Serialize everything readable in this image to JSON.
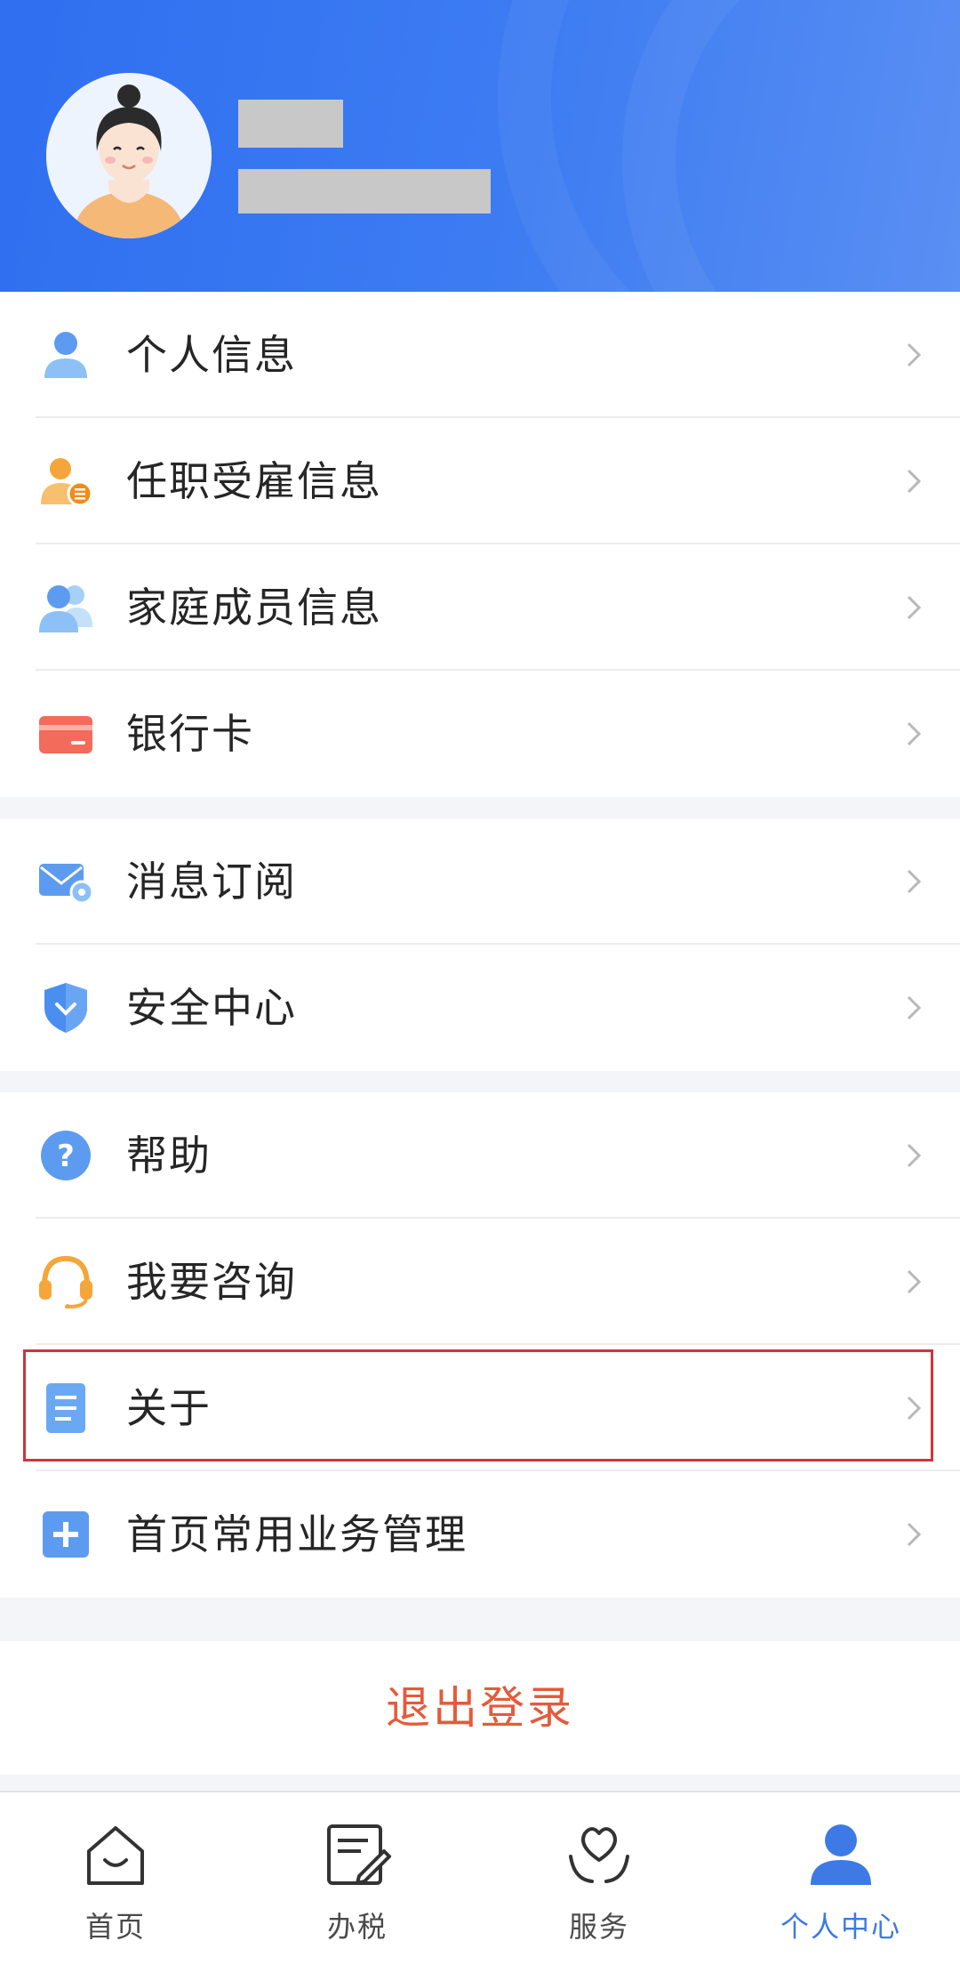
{
  "profile": {
    "name": "",
    "id": ""
  },
  "menu": {
    "group1": [
      {
        "label": "个人信息",
        "icon": "person-icon"
      },
      {
        "label": "任职受雇信息",
        "icon": "employment-icon"
      },
      {
        "label": "家庭成员信息",
        "icon": "family-icon"
      },
      {
        "label": "银行卡",
        "icon": "bank-card-icon"
      }
    ],
    "group2": [
      {
        "label": "消息订阅",
        "icon": "mail-settings-icon"
      },
      {
        "label": "安全中心",
        "icon": "shield-icon"
      }
    ],
    "group3": [
      {
        "label": "帮助",
        "icon": "help-icon"
      },
      {
        "label": "我要咨询",
        "icon": "headset-icon"
      },
      {
        "label": "关于",
        "icon": "document-icon"
      },
      {
        "label": "首页常用业务管理",
        "icon": "plus-icon"
      }
    ]
  },
  "logout_label": "退出登录",
  "tabs": [
    {
      "label": "首页",
      "icon": "home-icon"
    },
    {
      "label": "办税",
      "icon": "tax-edit-icon"
    },
    {
      "label": "服务",
      "icon": "service-heart-icon"
    },
    {
      "label": "个人中心",
      "icon": "user-center-icon"
    }
  ],
  "colors": {
    "header_blue": "#3d7cf2",
    "accent_blue": "#3d7ae6",
    "logout_red": "#e35b3c",
    "highlight_red": "#d0343a"
  }
}
